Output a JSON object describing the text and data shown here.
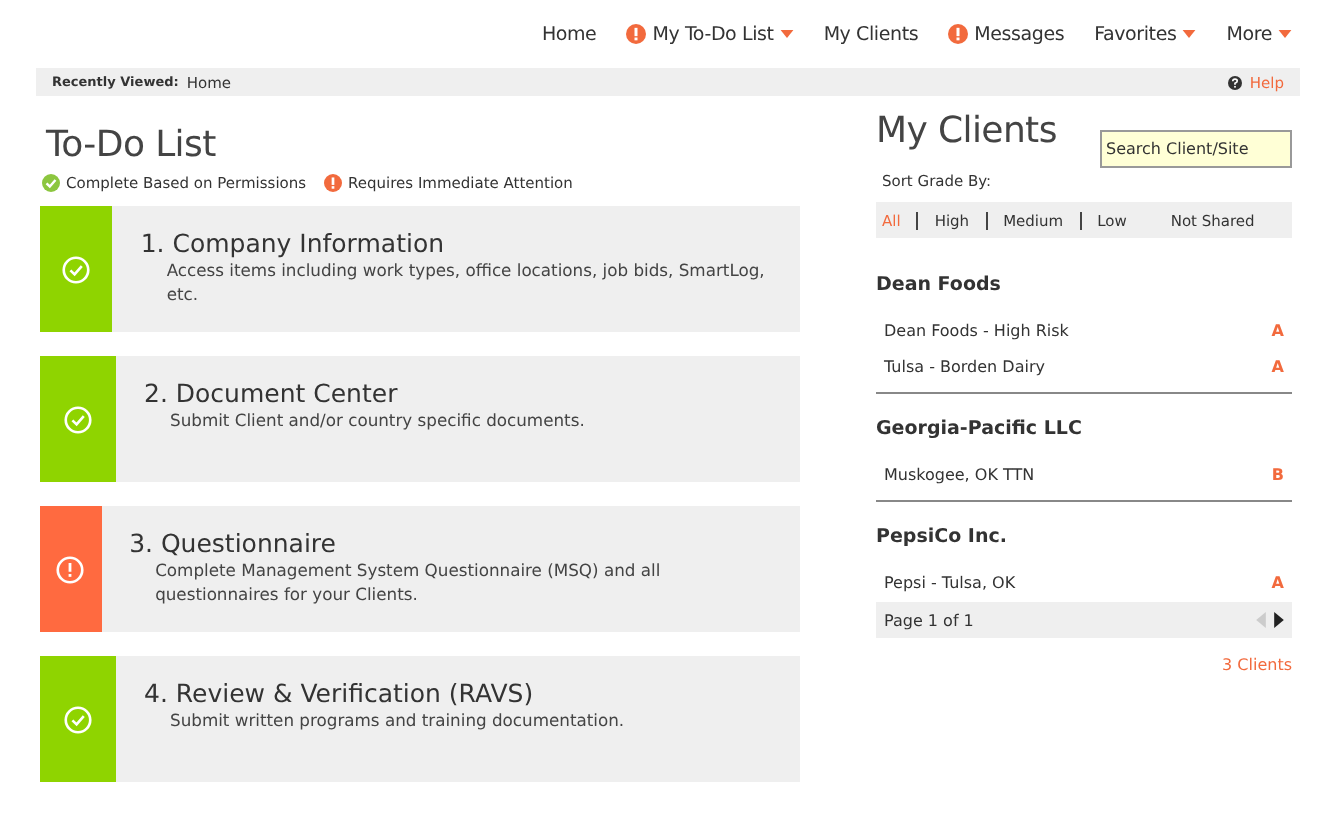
{
  "nav": [
    {
      "label": "Home",
      "alert": false,
      "dropdown": false
    },
    {
      "label": "My To-Do List",
      "alert": true,
      "dropdown": true
    },
    {
      "label": "My Clients",
      "alert": false,
      "dropdown": false
    },
    {
      "label": "Messages",
      "alert": true,
      "dropdown": false
    },
    {
      "label": "Favorites",
      "alert": false,
      "dropdown": true
    },
    {
      "label": "More",
      "alert": false,
      "dropdown": true
    }
  ],
  "breadcrumb": {
    "label": "Recently Viewed:",
    "current": "Home",
    "help": "Help"
  },
  "todo": {
    "title": "To-Do List",
    "legend": [
      {
        "kind": "complete",
        "label": "Complete Based on Permissions"
      },
      {
        "kind": "attention",
        "label": "Requires Immediate Attention"
      }
    ],
    "tasks": [
      {
        "kind": "complete",
        "title": "1. Company Information",
        "description": "Access items including work types, office locations, job bids, SmartLog, etc."
      },
      {
        "kind": "complete",
        "title": "2. Document Center",
        "description": "Submit Client and/or country specific documents."
      },
      {
        "kind": "attention",
        "title": "3. Questionnaire",
        "description": "Complete Management System Questionnaire (MSQ) and all questionnaires for your Clients."
      },
      {
        "kind": "complete",
        "title": "4. Review & Verification (RAVS)",
        "description": "Submit written programs and training documentation."
      }
    ]
  },
  "clients": {
    "title": "My Clients",
    "search": {
      "placeholder": "Search Client/Site"
    },
    "sort_label": "Sort Grade By:",
    "sort_options": [
      {
        "label": "All",
        "selected": true
      },
      {
        "label": "High",
        "selected": false
      },
      {
        "label": "Medium",
        "selected": false
      },
      {
        "label": "Low",
        "selected": false
      },
      {
        "label": "Not Shared",
        "selected": false
      }
    ],
    "groups": [
      {
        "name": "Dean Foods",
        "sites": [
          {
            "name": "Dean Foods - High Risk",
            "grade": "A"
          },
          {
            "name": "Tulsa - Borden Dairy",
            "grade": "A"
          }
        ]
      },
      {
        "name": "Georgia-Pacific LLC",
        "sites": [
          {
            "name": "Muskogee, OK TTN",
            "grade": "B"
          }
        ]
      },
      {
        "name": "PepsiCo Inc.",
        "sites": [
          {
            "name": "Pepsi - Tulsa, OK",
            "grade": "A"
          }
        ]
      }
    ],
    "pager": {
      "label": "Page 1 of 1",
      "prev_disabled": true,
      "next_disabled": false
    },
    "count": "3 Clients"
  }
}
